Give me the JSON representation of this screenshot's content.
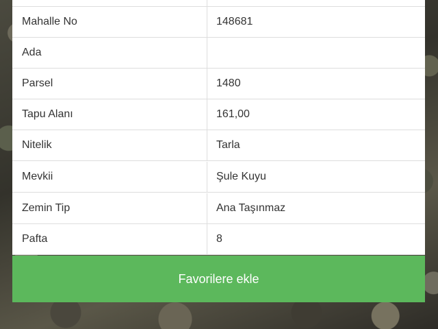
{
  "table": {
    "rows": [
      {
        "label": "",
        "value": ""
      },
      {
        "label": "Mahalle No",
        "value": "148681"
      },
      {
        "label": "Ada",
        "value": ""
      },
      {
        "label": "Parsel",
        "value": "1480"
      },
      {
        "label": "Tapu Alanı",
        "value": "161,00"
      },
      {
        "label": "Nitelik",
        "value": "Tarla"
      },
      {
        "label": "Mevkii",
        "value": "Şule Kuyu"
      },
      {
        "label": "Zemin Tip",
        "value": "Ana Taşınmaz"
      },
      {
        "label": "Pafta",
        "value": "8"
      }
    ]
  },
  "actions": {
    "favorite_label": "Favorilere ekle"
  },
  "colors": {
    "button_green": "#5cb85c",
    "table_border": "#dddddd"
  }
}
